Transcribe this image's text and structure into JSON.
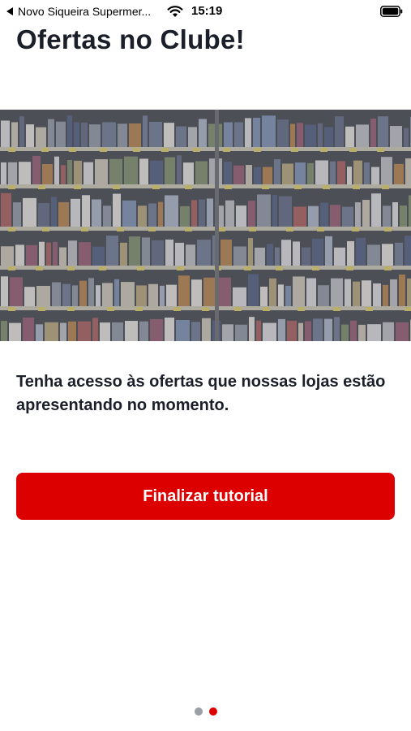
{
  "status_bar": {
    "back_app_label": "Novo Siqueira Supermer...",
    "time": "15:19",
    "icons": [
      "back-triangle-icon",
      "wifi-icon",
      "battery-icon"
    ]
  },
  "page": {
    "title": "Ofertas no Clube!",
    "description": "Tenha acesso às ofertas que nossas lojas estão apresentando no momento.",
    "hero_image": "supermarket-shelves-image"
  },
  "actions": {
    "finish_label": "Finalizar tutorial"
  },
  "pager": {
    "total": 2,
    "current": 2
  },
  "colors": {
    "accent": "#dd0000",
    "text": "#1b1f2a",
    "dot_inactive": "#9aa0a6",
    "dot_active": "#dd0000"
  }
}
